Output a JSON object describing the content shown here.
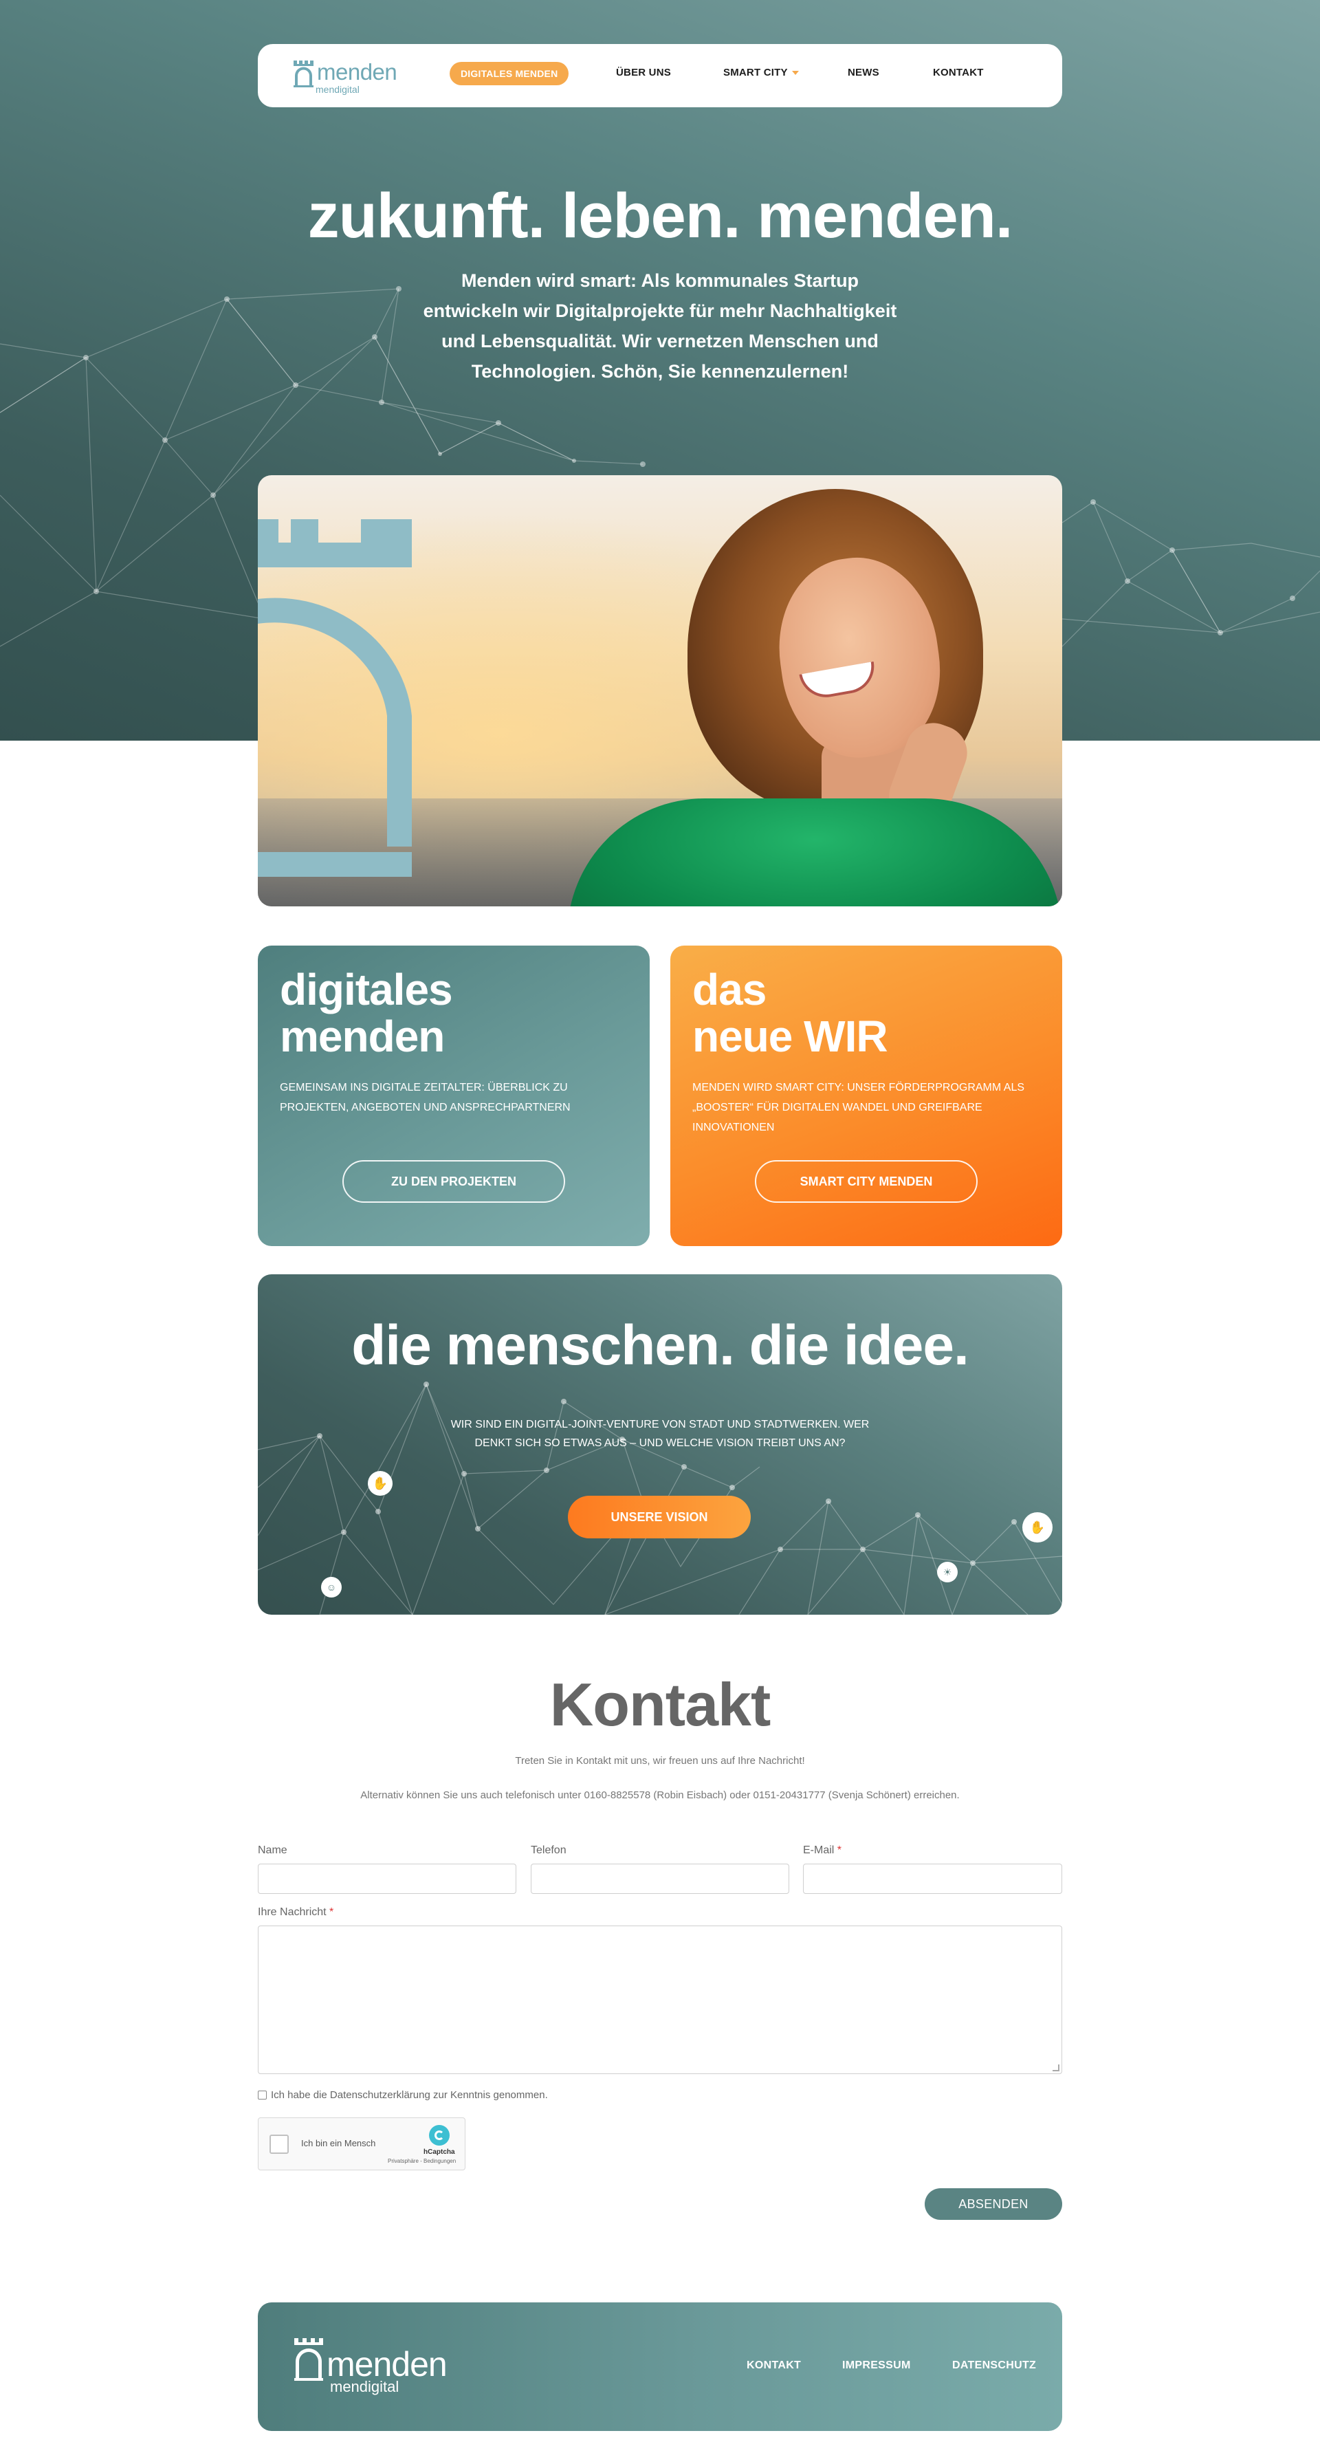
{
  "logo": {
    "word": "menden",
    "sub": "mendigital"
  },
  "nav": {
    "items": [
      {
        "label": "DIGITALES MENDEN",
        "active": true
      },
      {
        "label": "ÜBER UNS"
      },
      {
        "label": "SMART CITY",
        "has_dropdown": true
      },
      {
        "label": "NEWS"
      },
      {
        "label": "KONTAKT"
      }
    ]
  },
  "hero": {
    "title": "zukunft. leben. menden.",
    "text": "Menden wird smart: Als kommunales Startup entwickeln wir Digitalprojekte für mehr Nachhaltigkeit und Lebensqualität. Wir vernetzen Menschen und Technologien. Schön, Sie kennenzulernen!"
  },
  "cards": [
    {
      "title_line1": "digitales",
      "title_line2": "menden",
      "text": "GEMEINSAM INS DIGITALE ZEITALTER: ÜBERBLICK ZU PROJEKTEN, ANGEBOTEN UND ANSPRECHPARTNERN",
      "button": "ZU DEN PROJEKTEN"
    },
    {
      "title_line1": "das",
      "title_line2": "neue WIR",
      "text": "MENDEN WIRD SMART CITY: UNSER FÖRDERPROGRAMM ALS „BOOSTER“ FÜR DIGITALEN WANDEL UND GREIFBARE INNOVATIONEN",
      "button": "SMART CITY MENDEN"
    }
  ],
  "banner": {
    "title": "die menschen. die idee.",
    "text": "WIR SIND EIN DIGITAL-JOINT-VENTURE VON STADT UND STADTWERKEN. WER DENKT SICH SO ETWAS AUS – UND WELCHE VISION TREIBT UNS AN?",
    "button": "UNSERE VISION"
  },
  "contact": {
    "title": "Kontakt",
    "line1": "Treten Sie in Kontakt mit uns, wir freuen uns auf Ihre Nachricht!",
    "line2": "Alternativ können Sie uns auch telefonisch unter 0160-8825578 (Robin Eisbach) oder 0151-20431777 (Svenja Schönert) erreichen.",
    "name_label": "Name",
    "phone_label": "Telefon",
    "email_label": "E-Mail",
    "message_label": "Ihre Nachricht",
    "required_mark": "*",
    "privacy_label": "Ich habe die Datenschutzerklärung zur Kenntnis genommen.",
    "captcha_label": "Ich bin ein Mensch",
    "captcha_brand": "hCaptcha",
    "captcha_links": "Privatsphäre - Bedingungen",
    "submit": "ABSENDEN"
  },
  "footer": {
    "logo_word": "menden",
    "logo_sub": "mendigital",
    "links": [
      "KONTAKT",
      "IMPRESSUM",
      "DATENSCHUTZ"
    ]
  },
  "colors": {
    "teal_dark": "#3d5d5c",
    "teal": "#5a8483",
    "orange": "#fb8c2a",
    "nav_active": "#f6a94c",
    "logo_blue": "#6fa8b5"
  }
}
